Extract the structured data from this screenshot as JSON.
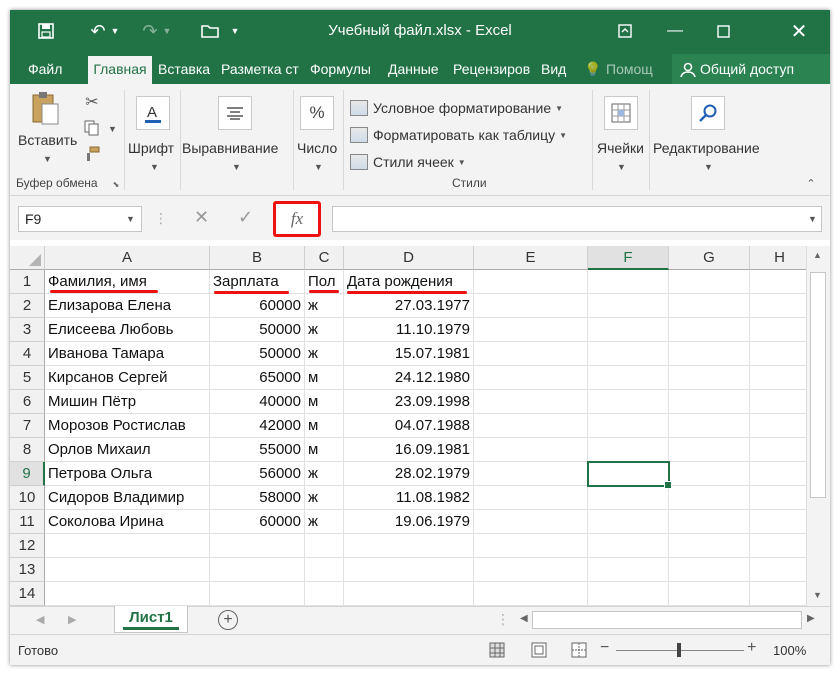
{
  "title_bar": {
    "title": "Учебный файл.xlsx - Excel",
    "save_icon": "save-icon",
    "undo_icon": "undo-icon",
    "redo_icon": "redo-icon",
    "open_icon": "open-folder-icon"
  },
  "tabs": [
    "Файл",
    "Главная",
    "Вставка",
    "Разметка ст",
    "Формулы",
    "Данные",
    "Рецензиров",
    "Вид"
  ],
  "active_tab": "Главная",
  "tell_me": "Помощ",
  "share": "Общий доступ",
  "ribbon": {
    "clipboard": {
      "paste": "Вставить",
      "group": "Буфер обмена"
    },
    "font": "Шрифт",
    "alignment": "Выравнивание",
    "number": "Число",
    "styles": {
      "conditional": "Условное форматирование",
      "as_table": "Форматировать как таблицу",
      "cell_styles": "Стили ячеек",
      "group": "Стили"
    },
    "cells": "Ячейки",
    "editing": "Редактирование"
  },
  "formula_bar": {
    "name_box": "F9",
    "fx": "fx",
    "value": ""
  },
  "columns": [
    "A",
    "B",
    "C",
    "D",
    "E",
    "F",
    "G",
    "H"
  ],
  "selected_column": "F",
  "selected_row": "9",
  "rows": [
    {
      "n": "1",
      "a": "Фамилия, имя",
      "b": "Зарплата",
      "c": "Пол",
      "d": "Дата рождения"
    },
    {
      "n": "2",
      "a": "Елизарова Елена",
      "b": "60000",
      "c": "ж",
      "d": "27.03.1977"
    },
    {
      "n": "3",
      "a": "Елисеева Любовь",
      "b": "50000",
      "c": "ж",
      "d": "11.10.1979"
    },
    {
      "n": "4",
      "a": "Иванова Тамара",
      "b": "50000",
      "c": "ж",
      "d": "15.07.1981"
    },
    {
      "n": "5",
      "a": "Кирсанов Сергей",
      "b": "65000",
      "c": "м",
      "d": "24.12.1980"
    },
    {
      "n": "6",
      "a": "Мишин Пётр",
      "b": "40000",
      "c": "м",
      "d": "23.09.1998"
    },
    {
      "n": "7",
      "a": "Морозов Ростислав",
      "b": "42000",
      "c": "м",
      "d": "04.07.1988"
    },
    {
      "n": "8",
      "a": "Орлов Михаил",
      "b": "55000",
      "c": "м",
      "d": "16.09.1981"
    },
    {
      "n": "9",
      "a": "Петрова Ольга",
      "b": "56000",
      "c": "ж",
      "d": "28.02.1979"
    },
    {
      "n": "10",
      "a": "Сидоров Владимир",
      "b": "58000",
      "c": "ж",
      "d": "11.08.1982"
    },
    {
      "n": "11",
      "a": "Соколова Ирина",
      "b": "60000",
      "c": "ж",
      "d": "19.06.1979"
    },
    {
      "n": "12",
      "a": "",
      "b": "",
      "c": "",
      "d": ""
    },
    {
      "n": "13",
      "a": "",
      "b": "",
      "c": "",
      "d": ""
    },
    {
      "n": "14",
      "a": "",
      "b": "",
      "c": "",
      "d": ""
    }
  ],
  "sheet_tab": "Лист1",
  "status": {
    "ready": "Готово",
    "zoom": "100%"
  },
  "colors": {
    "accent": "#217346",
    "highlight": "#ee1111"
  }
}
